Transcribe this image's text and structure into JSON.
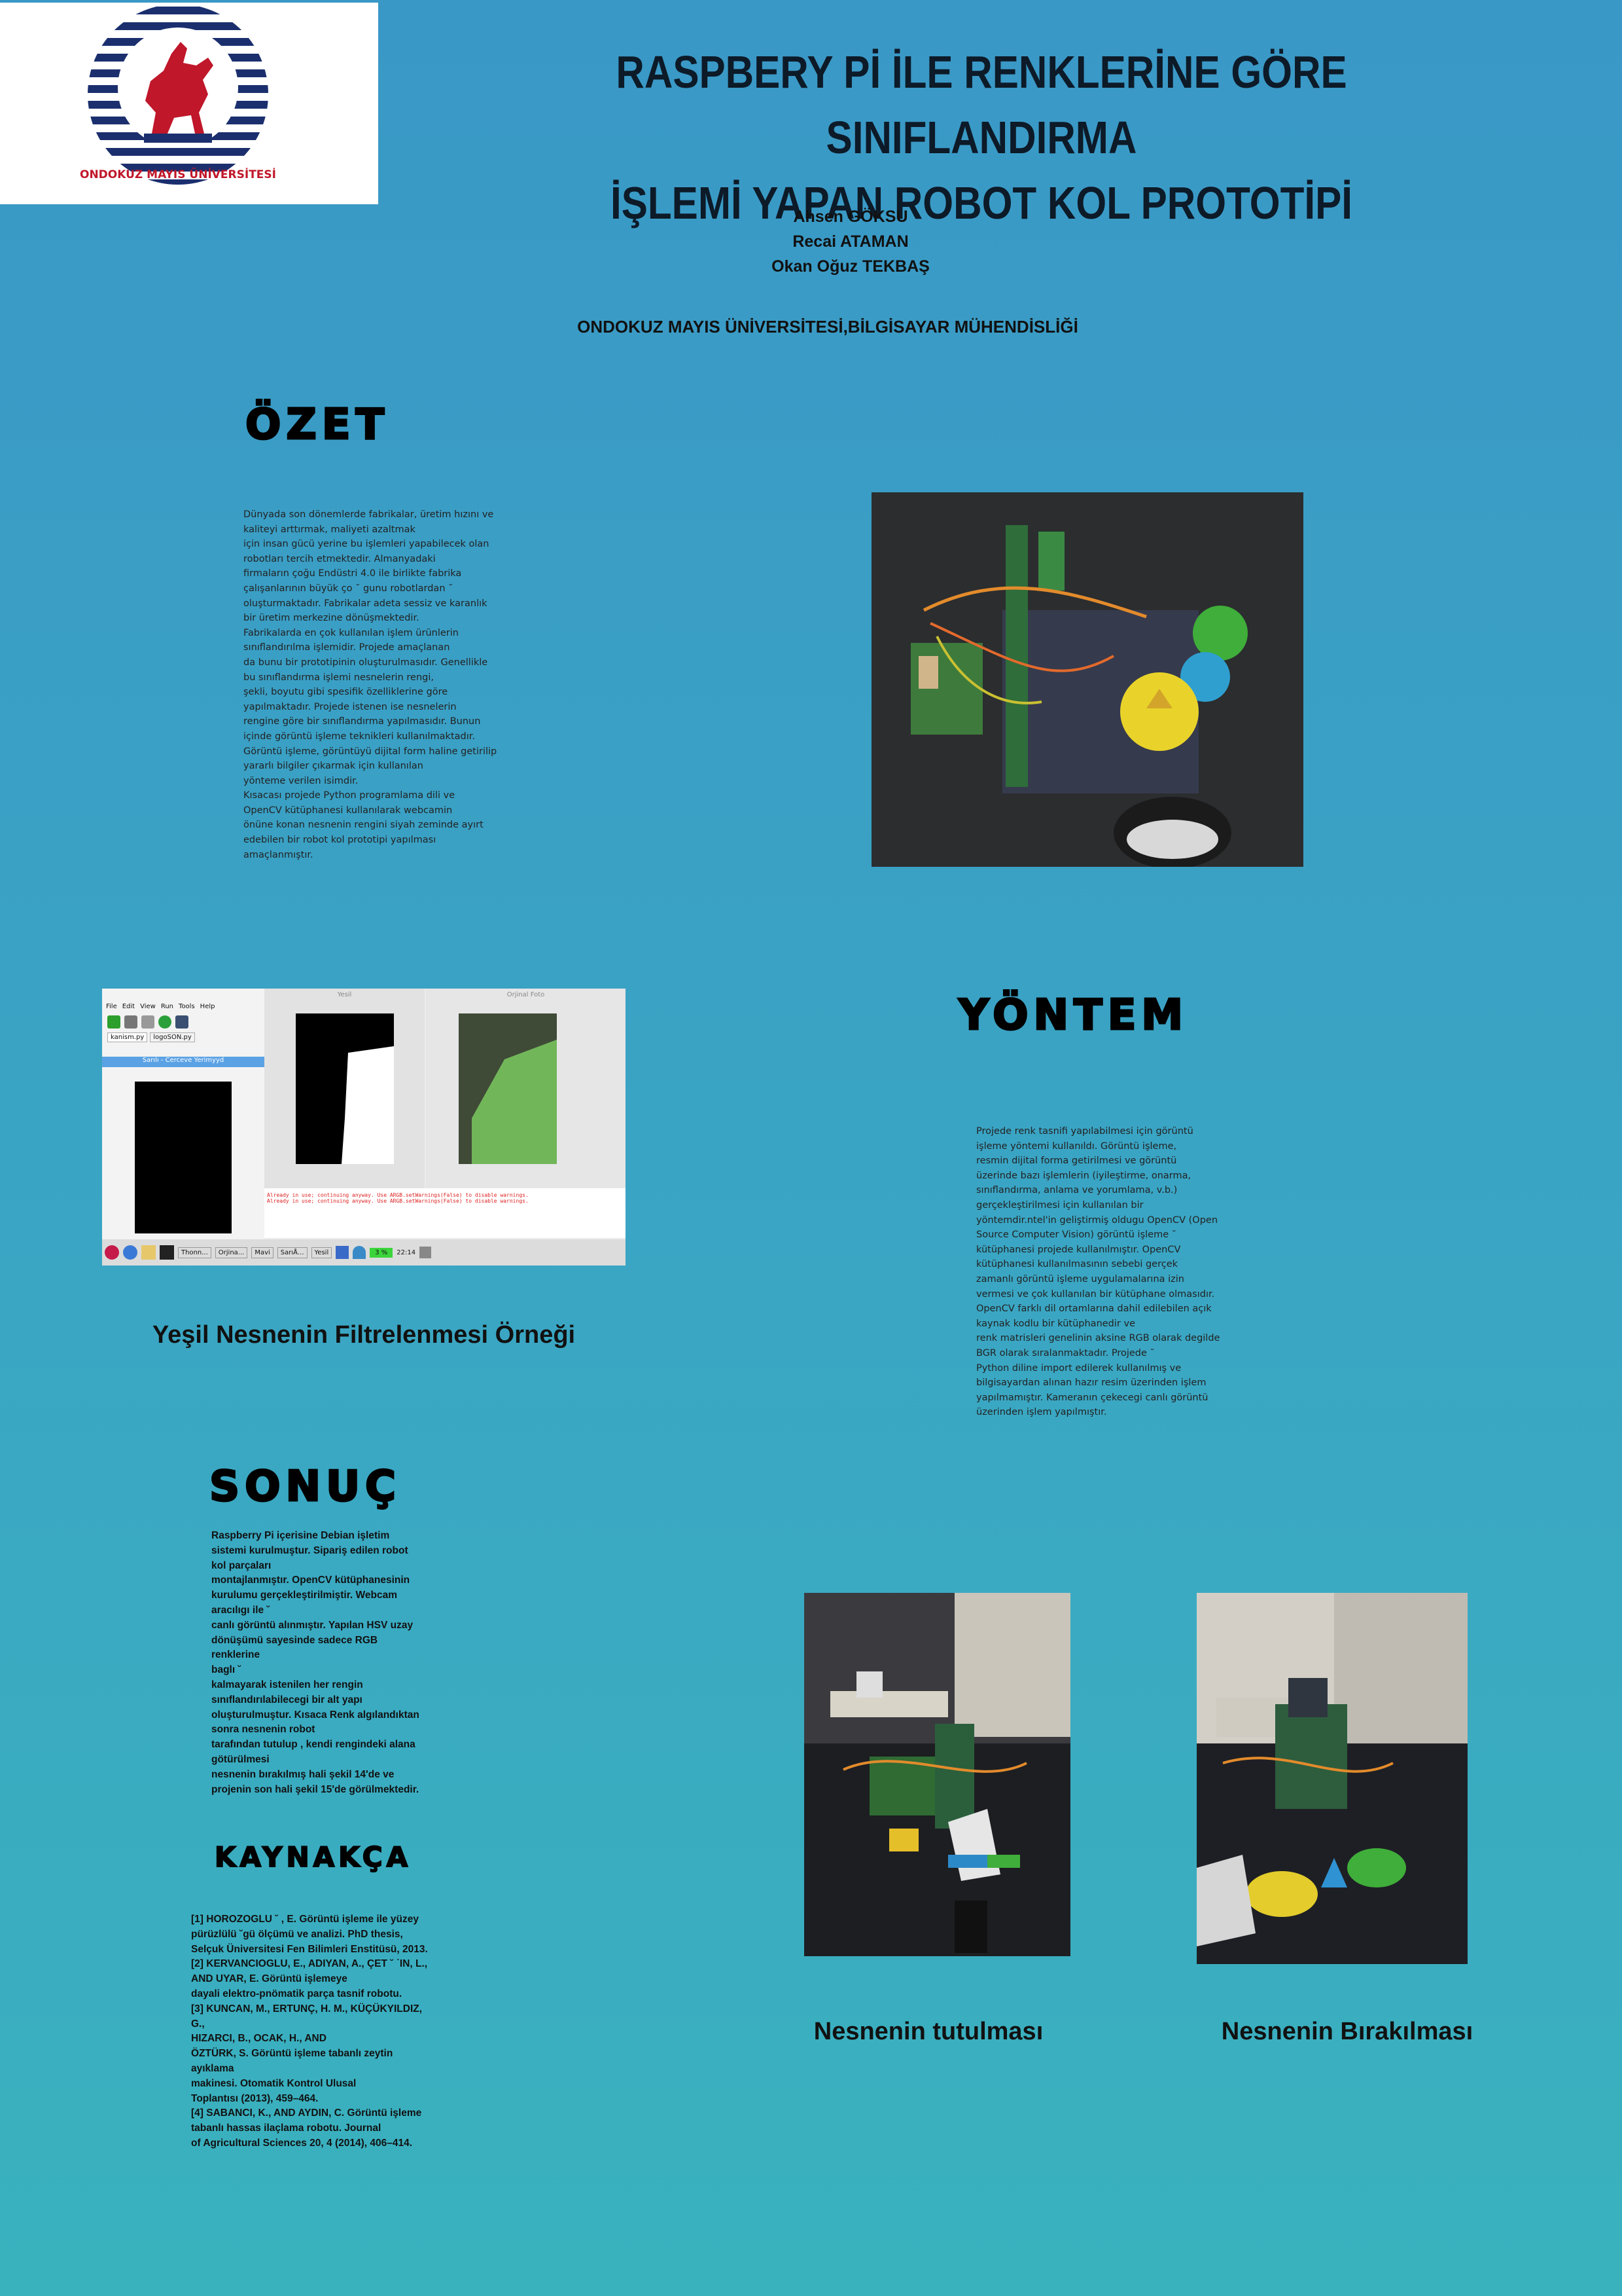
{
  "header": {
    "university_seal_text": "ONDOKUZ MAYIS ÜNİVERSİTESİ",
    "title_line1": "RASPBERY Pİ İLE RENKLERİNE GÖRE SINIFLANDIRMA",
    "title_line2": "İŞLEMİ YAPAN ROBOT KOL PROTOTİPİ",
    "authors": [
      "Ahsen GÖKSU",
      "Recai ATAMAN",
      "Okan Oğuz TEKBAŞ"
    ],
    "affiliation": "ONDOKUZ MAYIS ÜNİVERSİTESİ,BİLGİSAYAR MÜHENDİSLİĞİ"
  },
  "ozet": {
    "heading": "ÖZET",
    "text": " Dünyada son dönemlerde fabrikalar, üretim hızını ve\nkaliteyi arttırmak, maliyeti azaltmak\niçin insan gücü yerine bu işlemleri yapabilecek olan\nrobotları tercih etmektedir. Almanyadaki\nfirmaların çoğu Endüstri 4.0 ile birlikte fabrika\nçalışanlarının büyük ço ˘ gunu robotlardan ˘\noluşturmaktadır. Fabrikalar adeta sessiz ve karanlık\nbir üretim merkezine dönüşmektedir.\nFabrikalarda en çok kullanılan işlem ürünlerin\nsınıflandırılma işlemidir. Projede amaçlanan\nda bunu bir prototipinin oluşturulmasıdır. Genellikle\nbu sınıflandırma işlemi nesnelerin rengi,\nşekli, boyutu gibi spesifik özelliklerine göre\nyapılmaktadır. Projede istenen ise nesnelerin\nrengine göre bir sınıflandırma yapılmasıdır. Bunun\niçinde görüntü işleme teknikleri kullanılmaktadır.\nGörüntü işleme, görüntüyü dijital form haline getirilip\nyararlı bilgiler çıkarmak için kullanılan\nyönteme verilen isimdir.\nKısacası projede Python programlama dili ve\nOpenCV kütüphanesi kullanılarak webcamin\nönüne konan nesnenin rengini siyah zeminde ayırt\nedebilen bir robot kol prototipi yapılması\namaçlanmıştır."
  },
  "screenshot": {
    "menu_items": [
      "File",
      "Edit",
      "View",
      "Run",
      "Tools",
      "Help"
    ],
    "tabs": [
      "kanism.py",
      "logoSON.py"
    ],
    "window_yesil": "Yesil",
    "window_orijinal": "Orjinal Foto",
    "window_sarali": "Sarılı - Cerceve Yerimyyd",
    "console_line": "Already in use; continuing anyway.  Use ARGB.setWarnings(False) to disable warnings.",
    "taskbar_items": [
      "Thonn...",
      "Orjina...",
      "Mavi",
      "SarıÅ...",
      "Yesil"
    ],
    "clock": "22:14",
    "cpu": "3 %",
    "caption": "Yeşil Nesnenin Filtrelenmesi Örneği"
  },
  "yontem": {
    "heading": "YÖNTEM",
    "text": "Projede renk tasnifi yapılabilmesi için görüntü\nişleme yöntemi kullanıldı. Görüntü işleme,\nresmin dijital forma getirilmesi ve görüntü\nüzerinde bazı işlemlerin (iyileştirme, onarma,\nsınıflandırma, anlama ve yorumlama, v.b.)\ngerçekleştirilmesi için kullanılan bir\nyöntemdir.ntel'in geliştirmiş oldugu OpenCV (Open\nSource Computer Vision) görüntü işleme ˘\nkütüphanesi projede kullanılmıştır. OpenCV\nkütüphanesi kullanılmasının sebebi gerçek\nzamanlı görüntü işleme uygulamalarına izin\nvermesi ve çok kullanılan bir kütüphane olmasıdır.\nOpenCV farklı dil ortamlarına dahil edilebilen açık\nkaynak kodlu bir kütüphanedir ve\nrenk matrisleri genelinin aksine RGB olarak degilde\nBGR olarak sıralanmaktadır. Projede ˘\nPython diline import edilerek kullanılmış ve\nbilgisayardan alınan hazır resim üzerinden işlem\nyapılmamıştır. Kameranın çekecegi canlı görüntü\nüzerinden işlem yapılmıştır."
  },
  "sonuc": {
    "heading": "SONUÇ",
    "text": "Raspberry Pi içerisine Debian işletim\nsistemi kurulmuştur. Sipariş edilen robot\nkol parçaları\nmontajlanmıştır. OpenCV kütüphanesinin\nkurulumu gerçekleştirilmiştir. Webcam\naracılıgı ile ˘\ncanlı görüntü alınmıştır. Yapılan HSV uzay\ndönüşümü sayesinde sadece RGB renklerine\nbaglı ˘\nkalmayarak istenilen her rengin\nsınıflandırılabilecegi bir alt yapı\noluşturulmuştur. Kısaca Renk algılandıktan\nsonra nesnenin robot\ntarafından tutulup ,  kendi rengindeki alana\ngötürülmesi\nnesnenin bırakılmış hali şekil 14'de ve\nprojenin son hali şekil 15'de görülmektedir."
  },
  "kaynakca": {
    "heading": "KAYNAKÇA",
    "text": "[1] HOROZOGLU ˘ , E. Görüntü işleme ile yüzey\npürüzlülü ˘gü ölçümü ve analizi. PhD thesis,\nSelçuk Üniversitesi Fen Bilimleri Enstitüsü, 2013.\n[2] KERVANCIOGLU, E., ADIYAN, A., ÇET ˘ ˙IN, L.,\nAND UYAR, E. Görüntü işlemeye\ndayali elektro-pnömatik parça tasnif robotu.\n[3] KUNCAN, M., ERTUNÇ, H. M., KÜÇÜKYILDIZ, G.,\nHIZARCI, B., OCAK, H., AND\nÖZTÜRK, S. Görüntü işleme tabanlı zeytin ayıklama\nmakinesi. Otomatik Kontrol Ulusal\nToplantısı (2013), 459–464.\n[4] SABANCI, K., AND AYDIN, C. Görüntü işleme\ntabanlı hassas ilaçlama robotu. Journal\nof Agricultural Sciences 20, 4 (2014), 406–414."
  },
  "captions": {
    "holding": "Nesnenin tutulması",
    "released": "Nesnenin Bırakılması"
  },
  "colors": {
    "bg_top": "#3a98c6",
    "bg_bottom": "#3ab2be",
    "seal_blue": "#1b2f6e",
    "seal_red": "#c0172a"
  }
}
